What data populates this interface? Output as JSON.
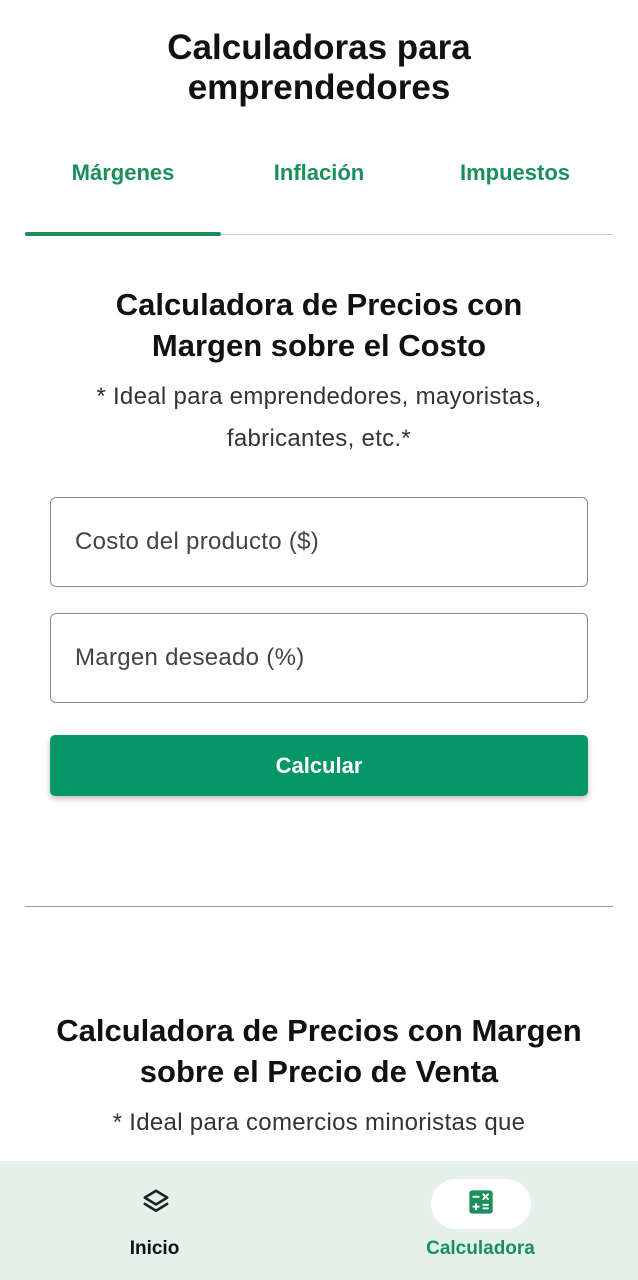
{
  "header": {
    "title": "Calculadoras para emprendedores"
  },
  "tabs": [
    {
      "label": "Márgenes",
      "active": true
    },
    {
      "label": "Inflación",
      "active": false
    },
    {
      "label": "Impuestos",
      "active": false
    }
  ],
  "section1": {
    "title": "Calculadora de Precios con Margen sobre el Costo",
    "description": "* Ideal para emprendedores, mayoristas, fabricantes, etc.*",
    "cost_input": {
      "placeholder": "Costo del producto ($)",
      "value": ""
    },
    "margin_input": {
      "placeholder": "Margen deseado (%)",
      "value": ""
    },
    "button_label": "Calcular"
  },
  "section2": {
    "title": "Calculadora de Precios con Margen sobre el Precio de Venta",
    "description": "* Ideal para comercios minoristas que"
  },
  "bottom_nav": {
    "items": [
      {
        "label": "Inicio",
        "icon": "layers-icon",
        "active": false
      },
      {
        "label": "Calculadora",
        "icon": "calculator-icon",
        "active": true
      }
    ]
  },
  "colors": {
    "accent": "#1a8f5c",
    "button": "#079667",
    "nav_background": "#e3f1ea"
  }
}
